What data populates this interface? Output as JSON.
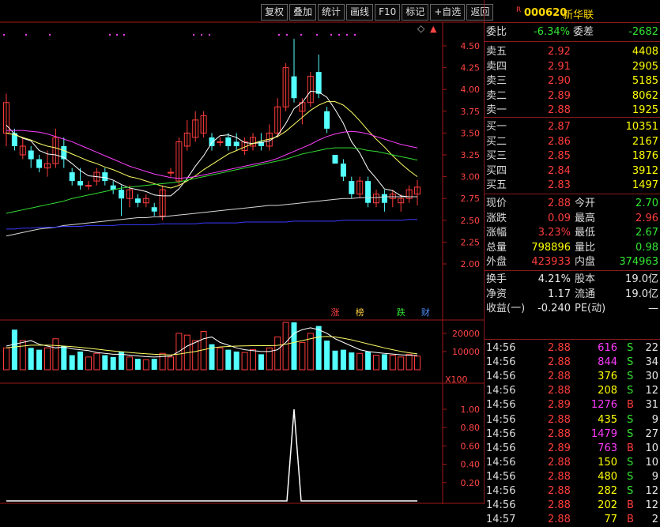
{
  "toolbar": {
    "buttons": [
      "复权",
      "叠加",
      "统计",
      "画线",
      "F10",
      "标记",
      "+自选",
      "返回"
    ]
  },
  "chart_data": [
    {
      "type": "candlestick",
      "price_ticks": [
        "4.50",
        "4.25",
        "4.00",
        "3.75",
        "3.50",
        "3.25",
        "3.00",
        "2.75",
        "2.50",
        "2.25",
        "2.00"
      ],
      "ylim": [
        1.95,
        4.62
      ],
      "candles": [
        [
          3.5,
          3.85,
          3.95,
          3.35
        ],
        [
          3.5,
          3.35,
          3.55,
          3.3
        ],
        [
          3.25,
          3.35,
          3.45,
          3.2
        ],
        [
          3.3,
          3.2,
          3.35,
          3.1
        ],
        [
          3.2,
          3.1,
          3.25,
          3.05
        ],
        [
          3.1,
          3.15,
          3.3,
          3.0
        ],
        [
          3.15,
          3.45,
          3.55,
          3.1
        ],
        [
          3.35,
          3.2,
          3.45,
          3.1
        ],
        [
          3.05,
          2.95,
          3.1,
          2.9
        ],
        [
          2.95,
          2.9,
          3.1,
          2.85
        ],
        [
          2.9,
          2.9,
          2.95,
          2.85
        ],
        [
          2.95,
          3.05,
          3.1,
          2.9
        ],
        [
          3.05,
          2.95,
          3.1,
          2.9
        ],
        [
          2.9,
          2.85,
          2.95,
          2.8
        ],
        [
          2.85,
          2.75,
          2.9,
          2.55
        ],
        [
          2.75,
          2.85,
          2.9,
          2.65
        ],
        [
          2.75,
          2.7,
          2.8,
          2.65
        ],
        [
          2.7,
          2.75,
          2.8,
          2.65
        ],
        [
          2.65,
          2.6,
          2.7,
          2.55
        ],
        [
          2.55,
          2.85,
          2.9,
          2.5
        ],
        [
          3.05,
          3.05,
          3.1,
          3.0
        ],
        [
          2.95,
          3.4,
          3.45,
          2.9
        ],
        [
          3.35,
          3.5,
          3.65,
          3.3
        ],
        [
          3.45,
          3.65,
          3.75,
          3.4
        ],
        [
          3.5,
          3.7,
          3.75,
          3.45
        ],
        [
          3.45,
          3.35,
          3.5,
          3.3
        ],
        [
          3.4,
          3.4,
          3.45,
          3.35
        ],
        [
          3.45,
          3.35,
          3.5,
          3.3
        ],
        [
          3.4,
          3.35,
          3.5,
          3.3
        ],
        [
          3.3,
          3.4,
          3.45,
          3.25
        ],
        [
          3.35,
          3.45,
          3.5,
          3.3
        ],
        [
          3.4,
          3.35,
          3.5,
          3.3
        ],
        [
          3.35,
          3.5,
          3.6,
          3.3
        ],
        [
          3.5,
          3.8,
          3.9,
          3.45
        ],
        [
          3.8,
          4.25,
          4.3,
          3.75
        ],
        [
          4.15,
          3.9,
          4.58,
          3.85
        ],
        [
          3.75,
          3.85,
          3.9,
          3.6
        ],
        [
          3.85,
          4.15,
          4.2,
          3.8
        ],
        [
          4.2,
          3.95,
          4.4,
          3.9
        ],
        [
          3.75,
          3.55,
          3.8,
          3.5
        ],
        [
          3.25,
          3.15,
          3.25,
          3.15
        ],
        [
          3.15,
          3.0,
          3.2,
          2.95
        ],
        [
          2.95,
          2.8,
          3.0,
          2.75
        ],
        [
          2.8,
          2.95,
          3.0,
          2.75
        ],
        [
          2.95,
          2.7,
          3.0,
          2.65
        ],
        [
          2.7,
          2.8,
          2.85,
          2.65
        ],
        [
          2.8,
          2.7,
          2.85,
          2.6
        ],
        [
          2.75,
          2.8,
          2.85,
          2.65
        ],
        [
          2.7,
          2.75,
          2.8,
          2.6
        ],
        [
          2.75,
          2.85,
          2.9,
          2.7
        ],
        [
          2.8,
          2.88,
          2.96,
          2.67
        ]
      ],
      "ma_lines": [
        {
          "color": "#ffffff",
          "values": [
            3.59,
            3.49,
            3.44,
            3.41,
            3.3,
            3.26,
            3.25,
            3.22,
            3.15,
            3.07,
            3.01,
            3.0,
            2.99,
            2.96,
            2.91,
            2.87,
            2.85,
            2.83,
            2.79,
            2.78,
            2.78,
            2.86,
            2.98,
            3.12,
            3.24,
            3.39,
            3.47,
            3.48,
            3.45,
            3.39,
            3.38,
            3.39,
            3.41,
            3.47,
            3.61,
            3.78,
            3.85,
            3.98,
            3.97,
            3.91,
            3.77,
            3.61,
            3.4,
            3.27,
            3.09,
            2.98,
            2.86,
            2.84,
            2.78,
            2.77,
            2.77
          ]
        },
        {
          "color": "#ffff66",
          "values": [
            3.5,
            3.48,
            3.45,
            3.42,
            3.38,
            3.35,
            3.33,
            3.3,
            3.26,
            3.22,
            3.18,
            3.15,
            3.11,
            3.08,
            3.04,
            3.0,
            2.98,
            2.95,
            2.92,
            2.89,
            2.87,
            2.9,
            2.95,
            3.01,
            3.08,
            3.14,
            3.2,
            3.26,
            3.3,
            3.34,
            3.38,
            3.41,
            3.43,
            3.46,
            3.52,
            3.6,
            3.68,
            3.76,
            3.82,
            3.86,
            3.86,
            3.82,
            3.74,
            3.64,
            3.53,
            3.43,
            3.34,
            3.24,
            3.15,
            3.07,
            3.0
          ]
        },
        {
          "color": "#ff40ff",
          "values": [
            3.53,
            3.53,
            3.53,
            3.52,
            3.51,
            3.49,
            3.46,
            3.43,
            3.4,
            3.36,
            3.32,
            3.28,
            3.24,
            3.2,
            3.16,
            3.12,
            3.09,
            3.06,
            3.03,
            3.01,
            2.99,
            2.98,
            2.99,
            3.0,
            3.02,
            3.04,
            3.06,
            3.08,
            3.1,
            3.12,
            3.14,
            3.16,
            3.18,
            3.21,
            3.25,
            3.29,
            3.33,
            3.37,
            3.42,
            3.46,
            3.49,
            3.51,
            3.52,
            3.51,
            3.49,
            3.46,
            3.43,
            3.4,
            3.37,
            3.35,
            3.33
          ]
        },
        {
          "color": "#33dd33",
          "values": [
            2.58,
            2.6,
            2.62,
            2.64,
            2.66,
            2.68,
            2.7,
            2.72,
            2.75,
            2.77,
            2.79,
            2.81,
            2.83,
            2.85,
            2.87,
            2.88,
            2.89,
            2.9,
            2.91,
            2.92,
            2.93,
            2.94,
            2.96,
            2.98,
            3.0,
            3.02,
            3.04,
            3.06,
            3.08,
            3.1,
            3.12,
            3.14,
            3.16,
            3.18,
            3.2,
            3.23,
            3.26,
            3.28,
            3.3,
            3.32,
            3.33,
            3.33,
            3.33,
            3.32,
            3.3,
            3.29,
            3.27,
            3.25,
            3.23,
            3.21,
            3.19
          ]
        },
        {
          "color": "#d8d8d8",
          "values": [
            2.32,
            2.34,
            2.36,
            2.38,
            2.4,
            2.41,
            2.42,
            2.44,
            2.45,
            2.46,
            2.47,
            2.48,
            2.49,
            2.5,
            2.51,
            2.52,
            2.53,
            2.53,
            2.54,
            2.54,
            2.55,
            2.56,
            2.57,
            2.58,
            2.59,
            2.6,
            2.61,
            2.62,
            2.63,
            2.64,
            2.65,
            2.66,
            2.67,
            2.67,
            2.68,
            2.69,
            2.7,
            2.71,
            2.72,
            2.73,
            2.74,
            2.75,
            2.75,
            2.76,
            2.76,
            2.76,
            2.77,
            2.77,
            2.77,
            2.77,
            2.77
          ]
        },
        {
          "color": "#3a3aff",
          "values": [
            2.4,
            2.4,
            2.41,
            2.41,
            2.42,
            2.42,
            2.42,
            2.43,
            2.43,
            2.43,
            2.44,
            2.44,
            2.44,
            2.44,
            2.45,
            2.45,
            2.45,
            2.45,
            2.45,
            2.46,
            2.46,
            2.46,
            2.46,
            2.46,
            2.47,
            2.47,
            2.47,
            2.47,
            2.47,
            2.48,
            2.48,
            2.48,
            2.48,
            2.48,
            2.48,
            2.49,
            2.49,
            2.49,
            2.49,
            2.49,
            2.49,
            2.5,
            2.5,
            2.5,
            2.5,
            2.5,
            2.5,
            2.5,
            2.5,
            2.51,
            2.51
          ]
        }
      ],
      "event_labels": [
        {
          "text": "涨",
          "color": "#ff4040",
          "index": 40
        },
        {
          "text": "榜",
          "color": "#ffd040",
          "index": 43
        },
        {
          "text": "跌",
          "color": "#30e030",
          "index": 48
        },
        {
          "text": "财",
          "color": "#5090ff",
          "index": 51
        }
      ],
      "volume_ticks": [
        "20000",
        "10000"
      ],
      "volume_unit": "X100",
      "volume_ylim": [
        0,
        26000
      ],
      "volumes": [
        12000,
        22000,
        16000,
        12000,
        11000,
        12000,
        17000,
        13000,
        8000,
        10000,
        7000,
        9000,
        8000,
        7000,
        10000,
        7000,
        6000,
        5500,
        6000,
        9000,
        7000,
        20000,
        19000,
        16000,
        21000,
        14000,
        12000,
        11000,
        10000,
        9500,
        11000,
        8500,
        12000,
        18000,
        27500,
        26000,
        15000,
        20000,
        24000,
        16000,
        10500,
        11000,
        9500,
        9000,
        10000,
        8000,
        8500,
        8000,
        7000,
        8500,
        7500
      ],
      "volume_ma": [
        {
          "color": "#ffffff",
          "values": [
            13000,
            14000,
            15000,
            16000,
            14000,
            13000,
            12000,
            12500,
            11500,
            11000,
            10500,
            9500,
            9000,
            8500,
            8500,
            8000,
            7600,
            7200,
            7000,
            7200,
            7500,
            10000,
            13000,
            15000,
            17000,
            18000,
            15000,
            13500,
            12000,
            11000,
            10500,
            10000,
            10000,
            11000,
            15000,
            20000,
            22000,
            23000,
            22000,
            20000,
            17000,
            15000,
            13000,
            11000,
            10000,
            9500,
            9000,
            8600,
            8200,
            8000,
            7800
          ]
        },
        {
          "color": "#ffff66",
          "values": [
            12000,
            12500,
            13000,
            13500,
            13500,
            13500,
            13300,
            13000,
            12700,
            12300,
            11800,
            11300,
            10800,
            10300,
            9900,
            9500,
            9100,
            8800,
            8500,
            8300,
            8100,
            8600,
            9300,
            10000,
            11000,
            12000,
            12500,
            12800,
            13000,
            13100,
            13200,
            13200,
            13200,
            13400,
            14000,
            15000,
            16000,
            17000,
            18000,
            18300,
            18000,
            17300,
            16400,
            15300,
            14200,
            13100,
            12000,
            11000,
            10100,
            9300,
            8700
          ]
        }
      ]
    },
    {
      "type": "line",
      "yticks": [
        "1.00",
        "0.80",
        "0.60",
        "0.40",
        "0.20"
      ],
      "ylim": [
        0,
        1.1
      ],
      "values": [
        0,
        0,
        0,
        0,
        0,
        0,
        0,
        0,
        0,
        0,
        0,
        0,
        0,
        0,
        0,
        0,
        0,
        0,
        0,
        0,
        0,
        0,
        0,
        0,
        0,
        0,
        0,
        0,
        0,
        0,
        0,
        0,
        0,
        0,
        0,
        1,
        0,
        0,
        0,
        0,
        0,
        0,
        0,
        0,
        0,
        0,
        0,
        0,
        0,
        0,
        0
      ],
      "color": "#ffffff"
    }
  ],
  "quote": {
    "flag": "R",
    "code": "000620",
    "name": "新华联",
    "weibi": {
      "label": "委比",
      "value": "-6.34%"
    },
    "weicha": {
      "label": "委差",
      "value": "-2682"
    },
    "sells": [
      {
        "label": "卖五",
        "price": "2.92",
        "vol": "4408"
      },
      {
        "label": "卖四",
        "price": "2.91",
        "vol": "2905"
      },
      {
        "label": "卖三",
        "price": "2.90",
        "vol": "5185"
      },
      {
        "label": "卖二",
        "price": "2.89",
        "vol": "8062"
      },
      {
        "label": "卖一",
        "price": "2.88",
        "vol": "1925"
      }
    ],
    "buys": [
      {
        "label": "买一",
        "price": "2.87",
        "vol": "10351"
      },
      {
        "label": "买二",
        "price": "2.86",
        "vol": "2167"
      },
      {
        "label": "买三",
        "price": "2.85",
        "vol": "1876"
      },
      {
        "label": "买四",
        "price": "2.84",
        "vol": "3912"
      },
      {
        "label": "买五",
        "price": "2.83",
        "vol": "1497"
      }
    ],
    "stats": [
      {
        "l1": "现价",
        "v1": "2.88",
        "c1": "red",
        "l2": "今开",
        "v2": "2.70",
        "c2": "green"
      },
      {
        "l1": "涨跌",
        "v1": "0.09",
        "c1": "red",
        "l2": "最高",
        "v2": "2.96",
        "c2": "red"
      },
      {
        "l1": "涨幅",
        "v1": "3.23%",
        "c1": "red",
        "l2": "最低",
        "v2": "2.67",
        "c2": "green"
      },
      {
        "l1": "总量",
        "v1": "798896",
        "c1": "yellow",
        "l2": "量比",
        "v2": "0.98",
        "c2": "green"
      },
      {
        "l1": "外盘",
        "v1": "423933",
        "c1": "red",
        "l2": "内盘",
        "v2": "374963",
        "c2": "green"
      }
    ],
    "fin": [
      {
        "l1": "换手",
        "v1": "4.21%",
        "l2": "股本",
        "v2": "19.0亿"
      },
      {
        "l1": "净资",
        "v1": "1.17",
        "l2": "流通",
        "v2": "19.0亿"
      },
      {
        "l1": "收益(一)",
        "v1": "-0.240",
        "l2": "PE(动)",
        "v2": "—"
      }
    ],
    "ticks": [
      {
        "time": "14:56",
        "price": "2.88",
        "vol": "616",
        "side": "S",
        "count": "22",
        "vc": "magenta"
      },
      {
        "time": "14:56",
        "price": "2.88",
        "vol": "844",
        "side": "S",
        "count": "34",
        "vc": "magenta"
      },
      {
        "time": "14:56",
        "price": "2.88",
        "vol": "376",
        "side": "S",
        "count": "30",
        "vc": "yellow"
      },
      {
        "time": "14:56",
        "price": "2.88",
        "vol": "208",
        "side": "S",
        "count": "12",
        "vc": "yellow"
      },
      {
        "time": "14:56",
        "price": "2.89",
        "vol": "1276",
        "side": "B",
        "count": "31",
        "vc": "magenta"
      },
      {
        "time": "14:56",
        "price": "2.88",
        "vol": "435",
        "side": "S",
        "count": "9",
        "vc": "yellow"
      },
      {
        "time": "14:56",
        "price": "2.88",
        "vol": "1479",
        "side": "S",
        "count": "27",
        "vc": "magenta"
      },
      {
        "time": "14:56",
        "price": "2.89",
        "vol": "763",
        "side": "B",
        "count": "10",
        "vc": "magenta"
      },
      {
        "time": "14:56",
        "price": "2.88",
        "vol": "150",
        "side": "S",
        "count": "10",
        "vc": "yellow"
      },
      {
        "time": "14:56",
        "price": "2.88",
        "vol": "480",
        "side": "S",
        "count": "9",
        "vc": "yellow"
      },
      {
        "time": "14:56",
        "price": "2.88",
        "vol": "282",
        "side": "S",
        "count": "12",
        "vc": "yellow"
      },
      {
        "time": "14:56",
        "price": "2.88",
        "vol": "202",
        "side": "B",
        "count": "12",
        "vc": "yellow"
      },
      {
        "time": "14:57",
        "price": "2.88",
        "vol": "77",
        "side": "B",
        "count": "2",
        "vc": "yellow"
      }
    ]
  }
}
